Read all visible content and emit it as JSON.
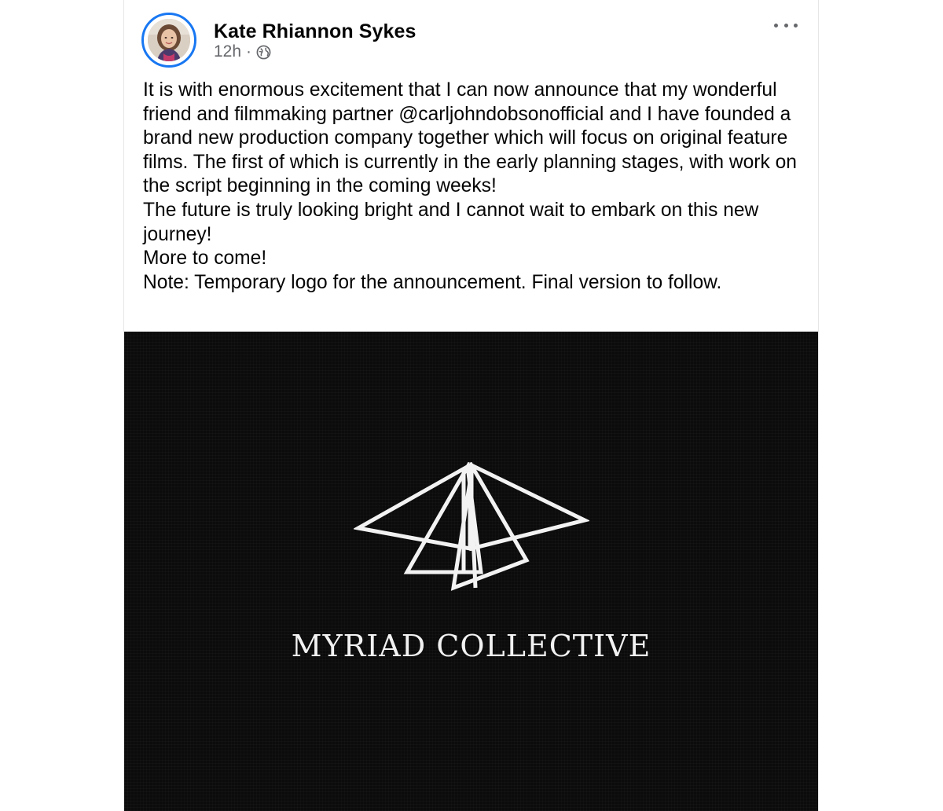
{
  "post": {
    "author": "Kate Rhiannon Sykes",
    "time": "12h",
    "separator": "·",
    "audience_icon": "globe-icon",
    "more_icon": "more-options-icon",
    "paragraphs": [
      "It is with enormous excitement that I can now announce that my wonderful friend and filmmaking partner @carljohndobsonofficial and I have founded a brand new production company together which will focus on original feature films. The first of which is currently in the early planning stages, with work on the script beginning in the coming weeks!",
      "The future is truly looking bright and I cannot wait to embark on this new journey!",
      "More to come!",
      "Note: Temporary logo for the announcement. Final version to follow."
    ],
    "image": {
      "logo_text": "MYRIAD COLLECTIVE",
      "background_color": "#0b0b0b",
      "logo_color": "#f2f2f2"
    }
  },
  "colors": {
    "accent": "#1877f2",
    "text": "#050505",
    "muted": "#65676b"
  }
}
